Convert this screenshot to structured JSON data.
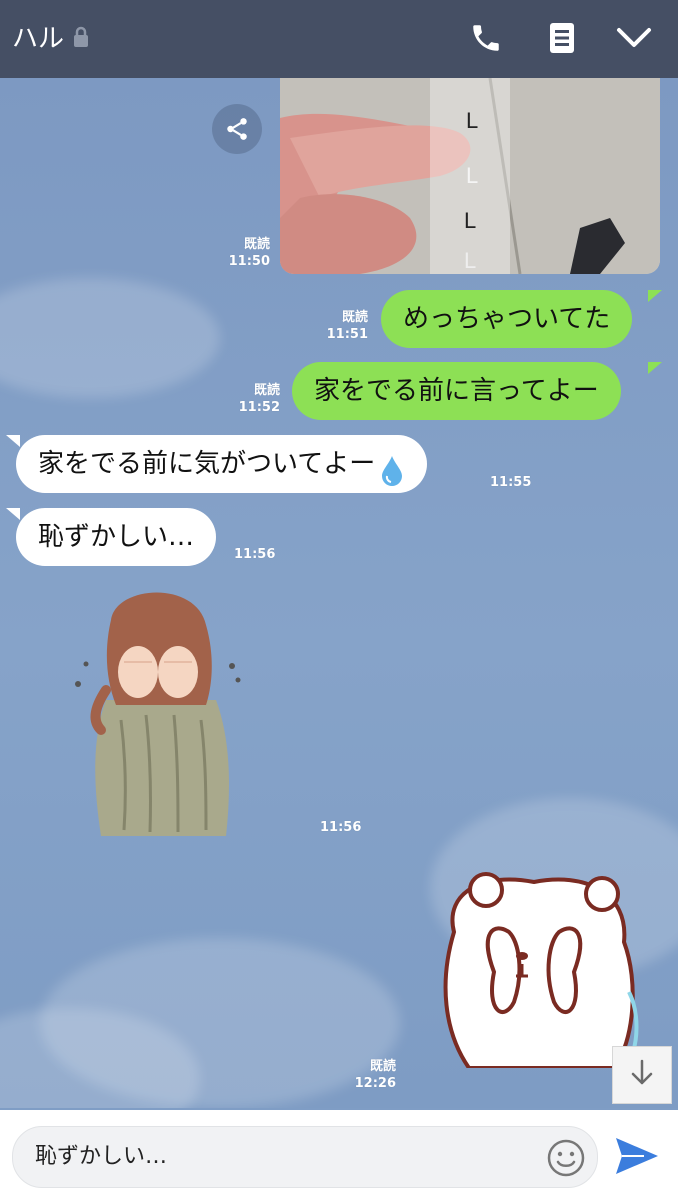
{
  "header": {
    "title": "ハル"
  },
  "messages": {
    "photo": {
      "read": "既読",
      "time": "11:50"
    },
    "m1": {
      "text": "めっちゃついてた",
      "read": "既読",
      "time": "11:51"
    },
    "m2": {
      "text": "家をでる前に言ってよー",
      "read": "既読",
      "time": "11:52"
    },
    "m3": {
      "text": "家をでる前に気がついてよー",
      "time": "11:55"
    },
    "m4": {
      "text": "恥ずかしい…",
      "time": "11:56"
    },
    "sticker_in": {
      "time": "11:56"
    },
    "sticker_out": {
      "read": "既読",
      "time": "12:26"
    }
  },
  "input": {
    "text": "恥ずかしい…"
  },
  "icons": [
    "lock-icon",
    "phone-icon",
    "memo-icon",
    "chevron-down-icon",
    "share-icon",
    "emoji-icon",
    "send-icon",
    "arrow-down-icon"
  ],
  "colors": {
    "header": "#454f64",
    "outgoing_bubble": "#8de055",
    "incoming_bubble": "#ffffff",
    "send": "#3b7ddd"
  }
}
